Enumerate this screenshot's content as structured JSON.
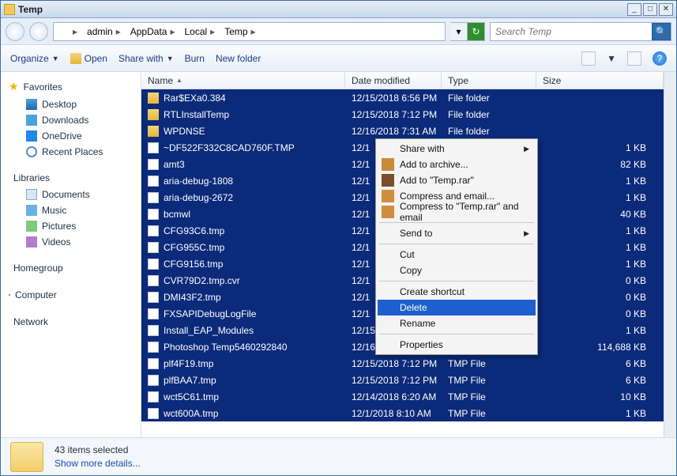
{
  "window": {
    "title": "Temp"
  },
  "breadcrumb": {
    "segments": [
      "admin",
      "AppData",
      "Local",
      "Temp"
    ]
  },
  "search": {
    "placeholder": "Search Temp"
  },
  "toolbar": {
    "organize": "Organize",
    "open": "Open",
    "share": "Share with",
    "burn": "Burn",
    "newfolder": "New folder"
  },
  "nav": {
    "favorites": "Favorites",
    "desktop": "Desktop",
    "downloads": "Downloads",
    "onedrive": "OneDrive",
    "recent": "Recent Places",
    "libraries": "Libraries",
    "documents": "Documents",
    "music": "Music",
    "pictures": "Pictures",
    "videos": "Videos",
    "homegroup": "Homegroup",
    "computer": "Computer",
    "network": "Network"
  },
  "columns": {
    "name": "Name",
    "date": "Date modified",
    "type": "Type",
    "size": "Size"
  },
  "files": [
    {
      "icon": "folder",
      "name": "Rar$EXa0.384",
      "date": "12/15/2018 6:56 PM",
      "type": "File folder",
      "size": ""
    },
    {
      "icon": "folder",
      "name": "RTLInstallTemp",
      "date": "12/15/2018 7:12 PM",
      "type": "File folder",
      "size": ""
    },
    {
      "icon": "folder",
      "name": "WPDNSE",
      "date": "12/16/2018 7:31 AM",
      "type": "File folder",
      "size": ""
    },
    {
      "icon": "file",
      "name": "~DF522F332C8CAD760F.TMP",
      "date": "12/1",
      "type": "",
      "size": "1 KB"
    },
    {
      "icon": "file",
      "name": "amt3",
      "date": "12/1",
      "type": "",
      "size": "82 KB"
    },
    {
      "icon": "file",
      "name": "aria-debug-1808",
      "date": "12/1",
      "type": "",
      "size": "1 KB"
    },
    {
      "icon": "file",
      "name": "aria-debug-2672",
      "date": "12/1",
      "type": "",
      "size": "1 KB"
    },
    {
      "icon": "file",
      "name": "bcmwl",
      "date": "12/1",
      "type": "",
      "size": "40 KB"
    },
    {
      "icon": "file",
      "name": "CFG93C6.tmp",
      "date": "12/1",
      "type": "",
      "size": "1 KB"
    },
    {
      "icon": "file",
      "name": "CFG955C.tmp",
      "date": "12/1",
      "type": "",
      "size": "1 KB"
    },
    {
      "icon": "file",
      "name": "CFG9156.tmp",
      "date": "12/1",
      "type": "",
      "size": "1 KB"
    },
    {
      "icon": "file",
      "name": "CVR79D2.tmp.cvr",
      "date": "12/1",
      "type": "",
      "size": "0 KB"
    },
    {
      "icon": "file",
      "name": "DMI43F2.tmp",
      "date": "12/1",
      "type": "",
      "size": "0 KB"
    },
    {
      "icon": "file",
      "name": "FXSAPIDebugLogFile",
      "date": "12/1",
      "type": "",
      "size": "0 KB"
    },
    {
      "icon": "file",
      "name": "Install_EAP_Modules",
      "date": "12/15/2018 7:11 PM",
      "type": "Text Document",
      "size": "1 KB"
    },
    {
      "icon": "file",
      "name": "Photoshop Temp5460292840",
      "date": "12/16/2018 9:57 AM",
      "type": "File",
      "size": "114,688 KB"
    },
    {
      "icon": "file",
      "name": "plf4F19.tmp",
      "date": "12/15/2018 7:12 PM",
      "type": "TMP File",
      "size": "6 KB"
    },
    {
      "icon": "file",
      "name": "plfBAA7.tmp",
      "date": "12/15/2018 7:12 PM",
      "type": "TMP File",
      "size": "6 KB"
    },
    {
      "icon": "file",
      "name": "wct5C61.tmp",
      "date": "12/14/2018 6:20 AM",
      "type": "TMP File",
      "size": "10 KB"
    },
    {
      "icon": "file",
      "name": "wct600A.tmp",
      "date": "12/1/2018 8:10 AM",
      "type": "TMP File",
      "size": "1 KB"
    }
  ],
  "contextmenu": {
    "sharewith": "Share with",
    "addarchive": "Add to archive...",
    "addtemprar": "Add to \"Temp.rar\"",
    "compressemail": "Compress and email...",
    "compresstemprar": "Compress to \"Temp.rar\" and email",
    "sendto": "Send to",
    "cut": "Cut",
    "copy": "Copy",
    "shortcut": "Create shortcut",
    "delete": "Delete",
    "rename": "Rename",
    "properties": "Properties"
  },
  "status": {
    "count": "43 items selected",
    "details": "Show more details..."
  }
}
